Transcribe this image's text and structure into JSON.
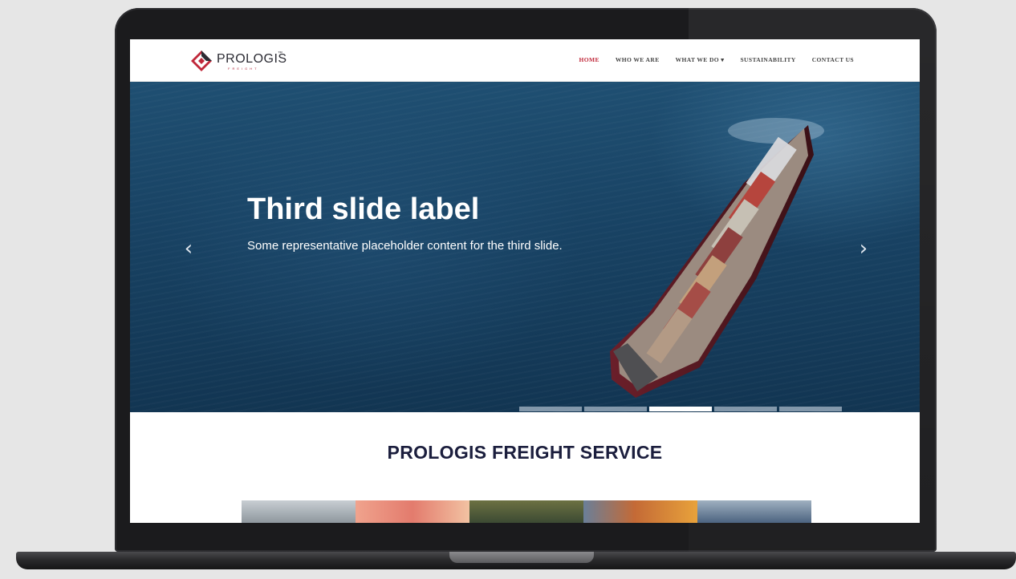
{
  "brand": {
    "name": "PROLOGIS",
    "tm": "™",
    "sub": "FREIGHT"
  },
  "nav": {
    "items": [
      {
        "label": "HOME",
        "active": true
      },
      {
        "label": "WHO WE ARE",
        "active": false
      },
      {
        "label": "WHAT WE DO ▾",
        "active": false
      },
      {
        "label": "SUSTAINABILITY",
        "active": false
      },
      {
        "label": "CONTACT US",
        "active": false
      }
    ]
  },
  "hero": {
    "title": "Third slide label",
    "text": "Some representative placeholder content for the third slide.",
    "prev_icon": "‹",
    "next_icon": "›",
    "slide_count": 5,
    "active_slide": 3
  },
  "section": {
    "title": "PROLOGIS FREIGHT SERVICE"
  },
  "colors": {
    "accent": "#c0283a",
    "navy": "#1b1e3d"
  }
}
